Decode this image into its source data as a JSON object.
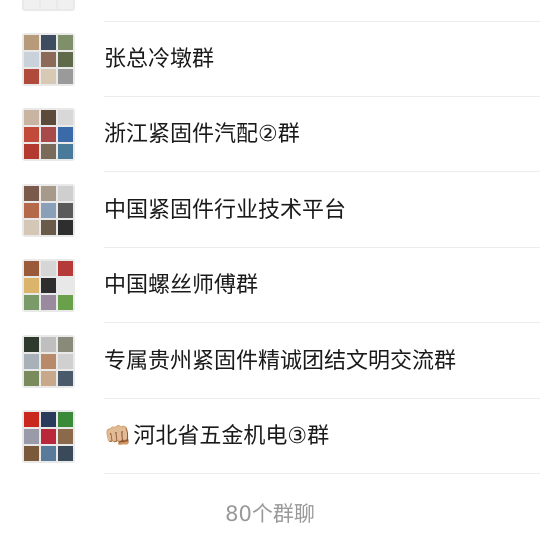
{
  "groups": [
    {
      "name": "",
      "tiles": [
        "#2b2b2b",
        "#5a6b7a",
        "#8a8a8a",
        "#cfcfcf",
        "#b8b8b8",
        "#dcdcdc",
        "#f0f0f0",
        "#f0f0f0",
        "#f0f0f0"
      ]
    },
    {
      "name": "张总冷墩群",
      "tiles": [
        "#b79a7a",
        "#3d4c5e",
        "#7e8f6a",
        "#c9d2da",
        "#8b6a5a",
        "#5f6a4a",
        "#b04a3a",
        "#d7c9b3",
        "#9a9a9a"
      ]
    },
    {
      "name": "浙江紧固件汽配②群",
      "tiles": [
        "#c8b4a0",
        "#5c4a3a",
        "#d8d8d8",
        "#c14a3a",
        "#a84a4a",
        "#3a6aa8",
        "#b23a2e",
        "#7a6a5a",
        "#4a7a9a"
      ]
    },
    {
      "name": "中国紧固件行业技术平台",
      "tiles": [
        "#7a5a4a",
        "#a89a8a",
        "#cfcfcf",
        "#b46a4a",
        "#8aa0b8",
        "#5a5a5a",
        "#d4c7b5",
        "#6a5a4a",
        "#2e2e2e"
      ]
    },
    {
      "name": "中国螺丝师傅群",
      "tiles": [
        "#9a5a3a",
        "#d6d6d6",
        "#b53a3a",
        "#d9b46a",
        "#2e2e2e",
        "#e8e8e8",
        "#7a9a6a",
        "#9a8aa0",
        "#6aa04a"
      ]
    },
    {
      "name": "专属贵州紧固件精诚团结文明交流群",
      "tiles": [
        "#2e3a2e",
        "#bfbfbf",
        "#8a8a7a",
        "#a8b0b8",
        "#b88a6a",
        "#d0d0d0",
        "#7a8a5a",
        "#c8a88a",
        "#4a5a6a"
      ]
    },
    {
      "name": "河北省五金机电③群",
      "emoji": "👊🏼",
      "tiles": [
        "#c8281e",
        "#2a3a5a",
        "#3a8a3a",
        "#9a9aa8",
        "#b8283a",
        "#8a6a4a",
        "#7a5a3a",
        "#5a7a9a",
        "#3a4a5a"
      ]
    }
  ],
  "footer": {
    "count_label": "80个群聊"
  }
}
